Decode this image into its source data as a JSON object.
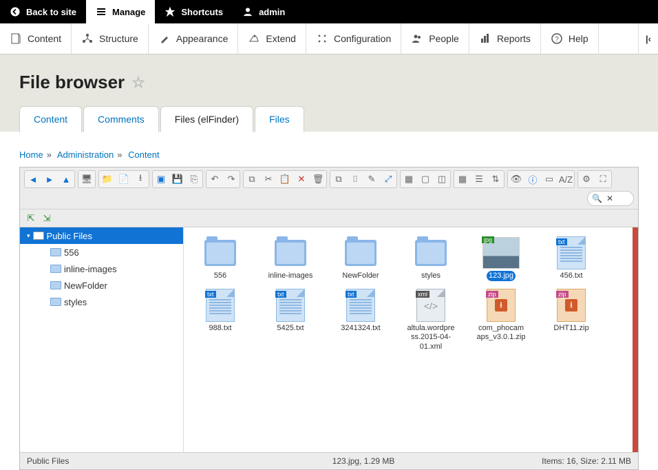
{
  "topbar": {
    "back": "Back to site",
    "manage": "Manage",
    "shortcuts": "Shortcuts",
    "user": "admin"
  },
  "adminmenu": {
    "content": "Content",
    "structure": "Structure",
    "appearance": "Appearance",
    "extend": "Extend",
    "configuration": "Configuration",
    "people": "People",
    "reports": "Reports",
    "help": "Help"
  },
  "page": {
    "title": "File browser"
  },
  "tabs": {
    "content": "Content",
    "comments": "Comments",
    "files_elfinder": "Files (elFinder)",
    "files": "Files"
  },
  "breadcrumb": {
    "home": "Home",
    "admin": "Administration",
    "content": "Content"
  },
  "tree": {
    "root": "Public Files",
    "children": [
      "556",
      "inline-images",
      "NewFolder",
      "styles"
    ]
  },
  "items": [
    {
      "kind": "folder",
      "name": "556"
    },
    {
      "kind": "folder",
      "name": "inline-images"
    },
    {
      "kind": "folder",
      "name": "NewFolder"
    },
    {
      "kind": "folder",
      "name": "styles"
    },
    {
      "kind": "jpg",
      "name": "123.jpg",
      "selected": true,
      "badge": "jpg"
    },
    {
      "kind": "txt",
      "name": "456.txt",
      "badge": "txt"
    },
    {
      "kind": "txt",
      "name": "988.txt",
      "badge": "txt"
    },
    {
      "kind": "txt",
      "name": "5425.txt",
      "badge": "txt"
    },
    {
      "kind": "txt",
      "name": "3241324.txt",
      "badge": "txt"
    },
    {
      "kind": "xml",
      "name": "altula.wordpress.2015-04-01.xml",
      "badge": "xml"
    },
    {
      "kind": "zip",
      "name": "com_phocamaps_v3.0.1.zip",
      "badge": "zip"
    },
    {
      "kind": "zip",
      "name": "DHT11.zip",
      "badge": "zip"
    }
  ],
  "status": {
    "path": "Public Files",
    "selected": "123.jpg, 1.29 MB",
    "totals": "Items: 16, Size: 2.11 MB"
  },
  "toolbar": {
    "search_x": "✕"
  }
}
